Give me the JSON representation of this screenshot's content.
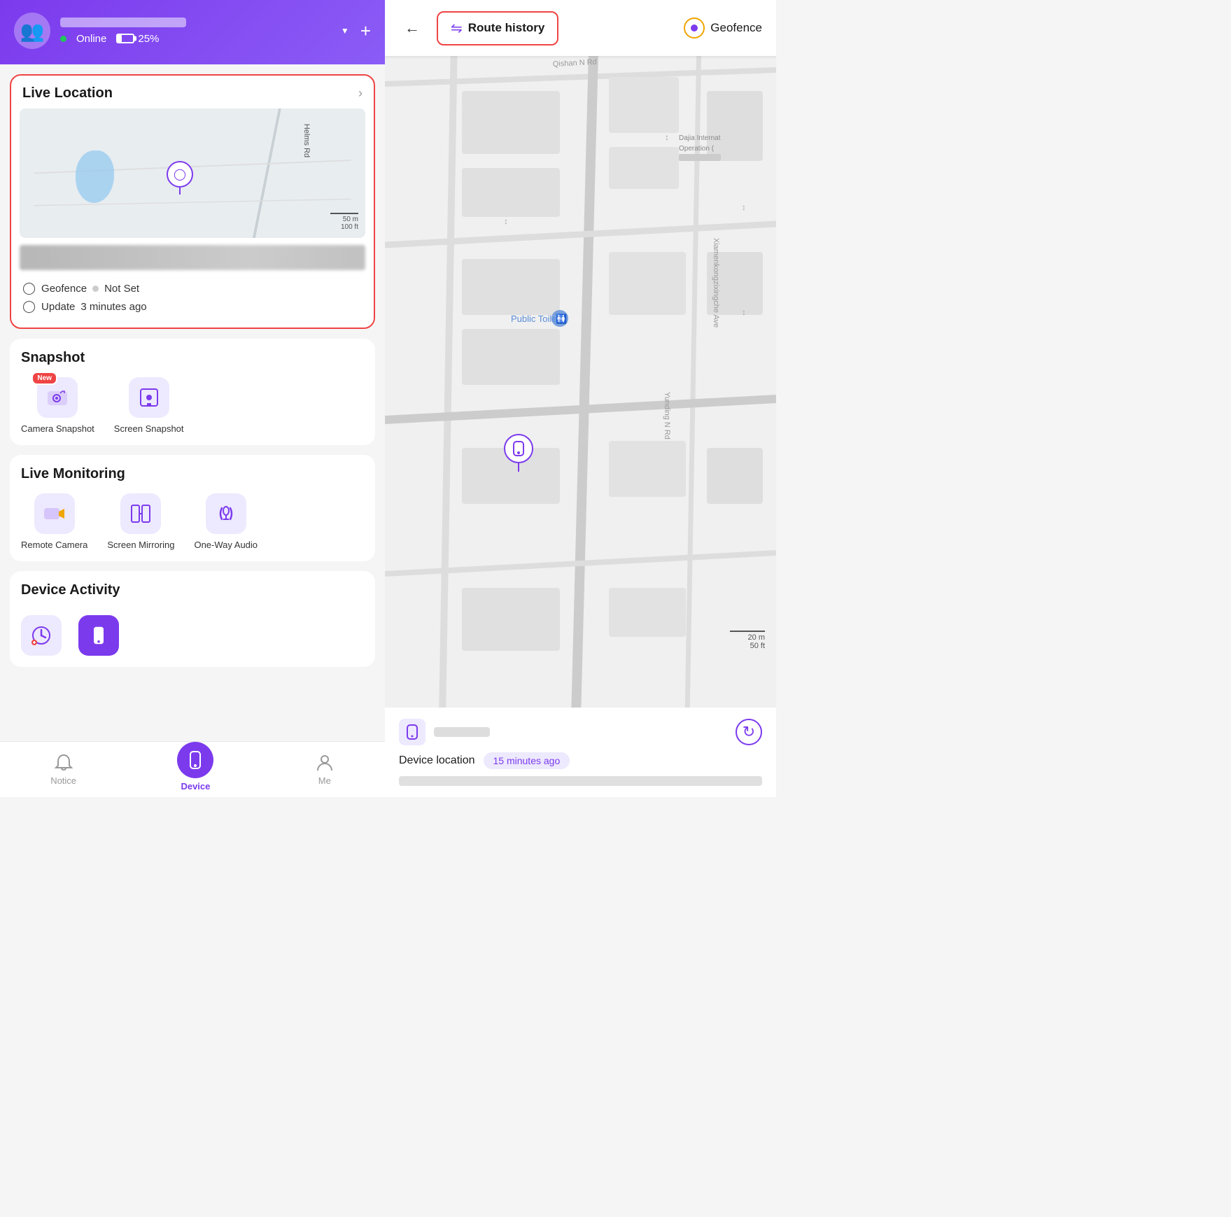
{
  "header": {
    "online_label": "Online",
    "battery_label": "25%",
    "dropdown_aria": "dropdown",
    "add_aria": "add"
  },
  "live_location": {
    "title": "Live Location",
    "geofence_label": "Geofence",
    "geofence_status": "Not Set",
    "update_label": "Update",
    "update_time": "3 minutes ago",
    "road_label": "Helms Rd",
    "scale_50m": "50 m",
    "scale_100ft": "100 ft"
  },
  "snapshot": {
    "title": "Snapshot",
    "camera_label": "Camera Snapshot",
    "screen_label": "Screen Snapshot",
    "new_badge": "New"
  },
  "live_monitoring": {
    "title": "Live Monitoring",
    "remote_camera_label": "Remote Camera",
    "screen_mirroring_label": "Screen Mirroring",
    "one_way_audio_label": "One-Way Audio"
  },
  "device_activity": {
    "title": "Device Activity"
  },
  "bottom_nav": {
    "notice_label": "Notice",
    "device_label": "Device",
    "me_label": "Me"
  },
  "map_header": {
    "route_history_label": "Route history",
    "geofence_label": "Geofence",
    "back_aria": "back"
  },
  "device_location": {
    "label": "Device location",
    "time_ago": "15 minutes ago",
    "refresh_aria": "refresh"
  },
  "map_scale": {
    "m": "20 m",
    "ft": "50 ft"
  }
}
